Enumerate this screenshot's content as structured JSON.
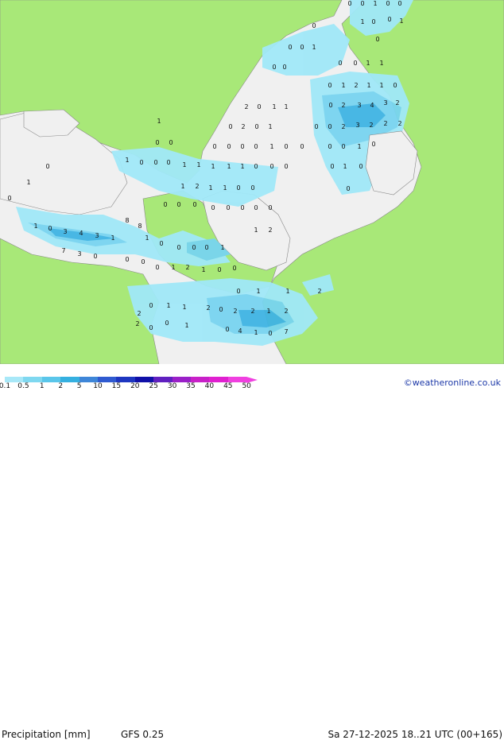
{
  "footer": {
    "title": "Precipitation [mm]",
    "model": "GFS 0.25",
    "datetime": "Sa 27-12-2025 18..21 UTC (00+165)",
    "credit": "©weatheronline.co.uk"
  },
  "legend": {
    "ticks": [
      "0.1",
      "0.5",
      "1",
      "2",
      "5",
      "10",
      "15",
      "20",
      "25",
      "30",
      "35",
      "40",
      "45",
      "50"
    ],
    "colors": [
      "#a8e8f8",
      "#7fd8f0",
      "#5ac6ea",
      "#35b0e0",
      "#3e86d8",
      "#2f5ad0",
      "#1e36c0",
      "#1010a8",
      "#6020c0",
      "#9a20c8",
      "#c820c8",
      "#e020d0",
      "#f040e0"
    ]
  },
  "map_colors": {
    "land": "#a8e878",
    "sea": "#f0f0f0",
    "light_precip": "#a0e8f8",
    "mid_precip": "#78d4f0",
    "heavy_precip": "#40b4e4",
    "border": "#888888"
  },
  "map_values": [
    "0",
    "0",
    "1",
    "0",
    "0",
    "0",
    "1",
    "0",
    "1",
    "0",
    "0",
    "0",
    "0",
    "1",
    "0",
    "0",
    "0",
    "0",
    "1",
    "1",
    "0",
    "1",
    "2",
    "1",
    "1",
    "0",
    "0",
    "2",
    "3",
    "4",
    "3",
    "2",
    "2",
    "0",
    "1",
    "1",
    "0",
    "0",
    "2",
    "3",
    "2",
    "2",
    "2",
    "0",
    "2",
    "0",
    "1",
    "1",
    "0",
    "0",
    "1",
    "0",
    "0",
    "0",
    "0",
    "0",
    "0",
    "0",
    "1",
    "0",
    "0",
    "1",
    "0",
    "0",
    "0",
    "1",
    "1",
    "1",
    "1",
    "1",
    "0",
    "0",
    "0",
    "0",
    "1",
    "0",
    "0",
    "1",
    "2",
    "1",
    "1",
    "0",
    "0",
    "0",
    "0",
    "0",
    "0",
    "0",
    "0",
    "0",
    "0",
    "0",
    "1",
    "0",
    "1",
    "0",
    "3",
    "4",
    "3",
    "1",
    "8",
    "8",
    "1",
    "0",
    "0",
    "0",
    "0",
    "1",
    "1",
    "2",
    "7",
    "3",
    "0",
    "0",
    "0",
    "0",
    "1",
    "2",
    "1",
    "0",
    "0",
    "0",
    "2",
    "1",
    "1",
    "2",
    "0",
    "2",
    "2",
    "1",
    "2",
    "0",
    "1",
    "0",
    "4",
    "1",
    "0",
    "7",
    "2",
    "0",
    "1",
    "0",
    "2",
    "1",
    "2",
    "1",
    "0",
    "0",
    "0",
    "1"
  ]
}
